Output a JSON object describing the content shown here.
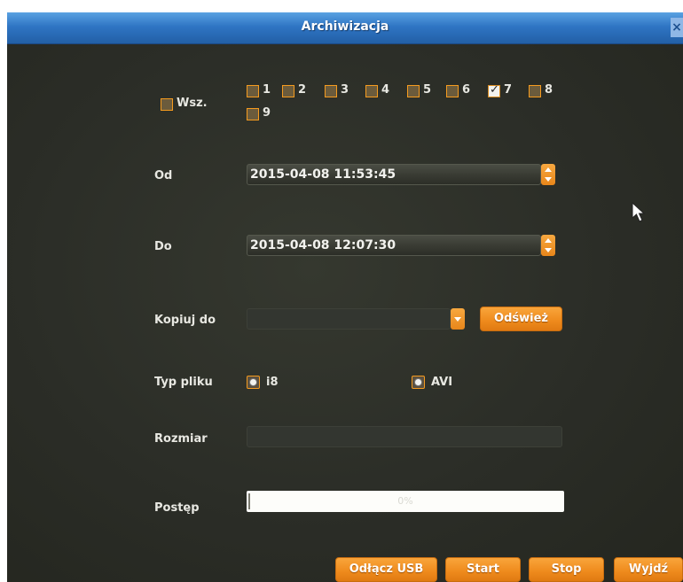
{
  "window": {
    "title": "Archiwizacja",
    "close_glyph": "×"
  },
  "channels": {
    "all_label": "Wsz.",
    "items": [
      {
        "label": "1",
        "checked": false
      },
      {
        "label": "2",
        "checked": false
      },
      {
        "label": "3",
        "checked": false
      },
      {
        "label": "4",
        "checked": false
      },
      {
        "label": "5",
        "checked": false
      },
      {
        "label": "6",
        "checked": false
      },
      {
        "label": "7",
        "checked": true
      },
      {
        "label": "8",
        "checked": false
      },
      {
        "label": "9",
        "checked": false
      }
    ]
  },
  "from": {
    "label": "Od",
    "value": "2015-04-08 11:53:45"
  },
  "to": {
    "label": "Do",
    "value": "2015-04-08 12:07:30"
  },
  "copy_to": {
    "label": "Kopiuj do",
    "value": "",
    "refresh_label": "Odśwież"
  },
  "file_type": {
    "label": "Typ pliku",
    "options": [
      {
        "label": "i8",
        "selected": true
      },
      {
        "label": "AVI",
        "selected": true
      }
    ]
  },
  "size": {
    "label": "Rozmiar",
    "value": ""
  },
  "progress": {
    "label": "Postęp",
    "text": "0%",
    "value": 0
  },
  "buttons": {
    "disconnect_usb": "Odłącz USB",
    "start": "Start",
    "stop": "Stop",
    "exit": "Wyjdź"
  },
  "colors": {
    "accent": "#ee8a1c",
    "title_bar": "#2f75c4",
    "background": "#2b2d27"
  }
}
